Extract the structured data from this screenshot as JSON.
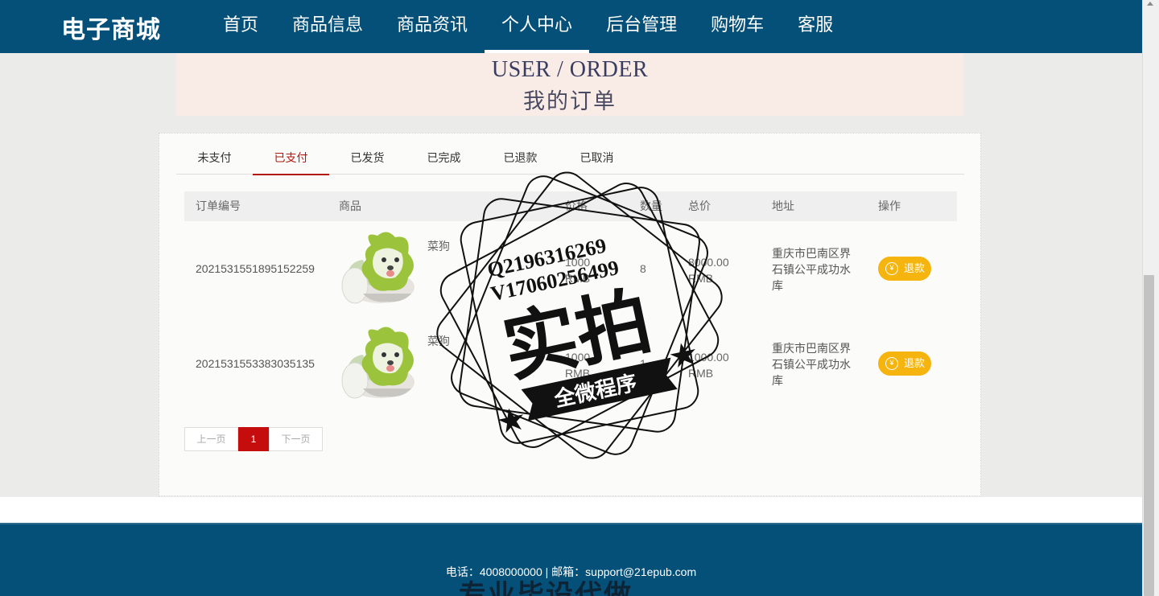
{
  "header": {
    "logo": "电子商城",
    "nav": [
      "首页",
      "商品信息",
      "商品资讯",
      "个人中心",
      "后台管理",
      "购物车",
      "客服"
    ],
    "active_nav_index": 3
  },
  "banner": {
    "title_en": "USER / ORDER",
    "title_cn": "我的订单"
  },
  "tabs": {
    "items": [
      "未支付",
      "已支付",
      "已发货",
      "已完成",
      "已退款",
      "已取消"
    ],
    "active_index": 1
  },
  "table": {
    "headers": {
      "order_no": "订单编号",
      "product": "商品",
      "price": "价格",
      "qty": "数量",
      "total": "总价",
      "address": "地址",
      "action": "操作"
    },
    "rows": [
      {
        "order_no": "2021531551895152259",
        "product_name": "菜狗",
        "price": "1000",
        "price_unit": "RMB",
        "qty": "8",
        "total": "8000.00",
        "total_unit": "RMB",
        "address": "重庆市巴南区界石镇公平成功水库",
        "action": "退款"
      },
      {
        "order_no": "2021531553383035135",
        "product_name": "菜狗",
        "price": "1000",
        "price_unit": "RMB",
        "qty": "1",
        "total": "1000.00",
        "total_unit": "RMB",
        "address": "重庆市巴南区界石镇公平成功水库",
        "action": "退款"
      }
    ]
  },
  "pagination": {
    "prev": "上一页",
    "current": "1",
    "next": "下一页"
  },
  "footer": {
    "contact": "电话：4008000000 | 邮箱：support@21epub.com"
  },
  "watermark": {
    "line1": "Q2196316269",
    "line2": "V17060256499",
    "main": "实拍",
    "ribbon": "全微程序",
    "bottom": "专业毕设代做"
  },
  "colors": {
    "header_bg": "#055078",
    "accent_red": "#b1180f",
    "refund_btn": "#f5b50e",
    "banner_bg": "#f9ece6"
  }
}
